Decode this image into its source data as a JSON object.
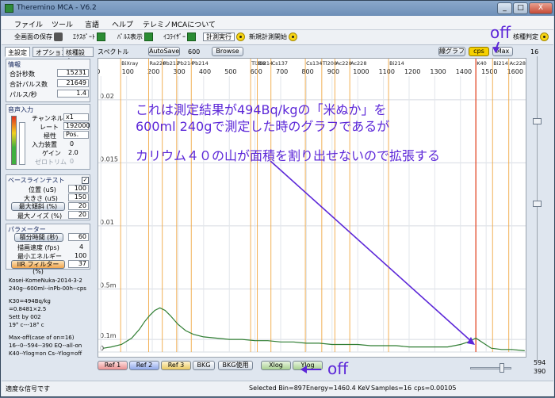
{
  "window": {
    "title": "Theremino MCA - V6.2"
  },
  "titlebar_buttons": {
    "minimize": "_",
    "maximize": "□",
    "close": "X"
  },
  "menu": [
    "ファイル",
    "ツール",
    "言語",
    "ヘルプ",
    "テレミノMCAについて"
  ],
  "toolbar": {
    "save_all": "全画面の保存",
    "export": "ｴｸｽﾎﾟｰﾄ",
    "pulse_display": "ﾊﾟﾙｽ表示",
    "equalizer": "ｲｺﾗｲｻﾞｰ",
    "measure_run": "計測実行",
    "new_measure": "新規計測開始",
    "nuclide_judge": "核種判定"
  },
  "tabs": [
    "主設定",
    "オプション",
    "核種設定"
  ],
  "info": {
    "title": "情報",
    "rows": [
      {
        "label": "合計秒数",
        "value": "15231"
      },
      {
        "label": "合計パルス数",
        "value": "21649"
      },
      {
        "label": "パルス/秒",
        "value": "1.4"
      }
    ]
  },
  "audio": {
    "title": "音声入力",
    "rows": [
      {
        "label": "チャンネル",
        "value": "x1"
      },
      {
        "label": "レート",
        "value": "192000"
      },
      {
        "label": "極性",
        "value": "Pos."
      },
      {
        "label": "入力装置",
        "value": "0"
      },
      {
        "label": "ゲイン",
        "value": "2.0"
      },
      {
        "label": "ゼロトリム",
        "value": "0"
      }
    ]
  },
  "baseline": {
    "title": "ベースラインテスト",
    "rows": [
      {
        "label": "位置 (uS)",
        "value": "100"
      },
      {
        "label": "大きさ (uS)",
        "value": "150"
      },
      {
        "label": "最大傾斜 (%)",
        "value": "20"
      },
      {
        "label": "最大ノイズ (%)",
        "value": "20"
      }
    ]
  },
  "params": {
    "title": "パラメーター",
    "rows": [
      {
        "label": "積分時間 (秒)",
        "value": "60"
      },
      {
        "label": "描画速度 (fps)",
        "value": "4"
      },
      {
        "label": "最小エネルギー",
        "value": "100"
      },
      {
        "label": "IIR フィルター (%)",
        "value": "37"
      }
    ]
  },
  "notes": [
    "Kosei-KomeNuka-2014-3-2",
    "240g--600ml--inPb-00h--cps",
    "",
    "K30=494Bq/kg",
    "=0.8481×2.5",
    "Sett by 002",
    "19° c---18° c",
    "",
    "Max-off(case of on=16)",
    "16--0--594--390  EQ--all-on",
    "K40--Ylog=on  Cs--Ylog=off"
  ],
  "spectrum": {
    "label": "スペクトル",
    "autosave": "AutoSave",
    "autosave_value": "600",
    "browse": "Browse",
    "line_graph": "線グラフ",
    "cps": "cps",
    "max": "Max",
    "scroll_top": "16"
  },
  "chart_data": {
    "type": "line",
    "x_ticks": [
      "0",
      "100",
      "200",
      "300",
      "400",
      "500",
      "600",
      "700",
      "800",
      "900",
      "1000",
      "1100",
      "1200",
      "1300",
      "1400",
      "1500",
      "1600"
    ],
    "y_ticks": [
      "0.02",
      "0.015",
      "0.01",
      "0.5m",
      "0.1m",
      "0"
    ],
    "xlim": [
      -10,
      1660
    ],
    "ylim": [
      0,
      0.0215
    ],
    "nuclide_labels": [
      {
        "name": "BiXray",
        "x": 77
      },
      {
        "name": "Ra226",
        "x": 186
      },
      {
        "name": "Pb212",
        "x": 239
      },
      {
        "name": "Pb214",
        "x": 295
      },
      {
        "name": "Pb214",
        "x": 352
      },
      {
        "name": "Tl208",
        "x": 583
      },
      {
        "name": "Bi214",
        "x": 609
      },
      {
        "name": "Cs137",
        "x": 662
      },
      {
        "name": "Tl208",
        "x": 860
      },
      {
        "name": "Cs134",
        "x": 796
      },
      {
        "name": "Ac228",
        "x": 911
      },
      {
        "name": "Ac228",
        "x": 969
      },
      {
        "name": "Bi214",
        "x": 1120
      },
      {
        "name": "K40",
        "x": 1460
      },
      {
        "name": "Bi214",
        "x": 1525
      },
      {
        "name": "Ac228",
        "x": 1588
      }
    ],
    "series": [
      {
        "x": [
          10,
          40,
          80,
          120,
          150,
          170,
          190,
          210,
          230,
          250,
          270,
          300,
          330,
          360,
          400,
          450,
          500,
          550,
          600,
          650,
          700,
          750,
          800,
          850,
          900,
          950,
          1000,
          1050,
          1100,
          1150,
          1200,
          1250,
          1300,
          1350,
          1400,
          1430,
          1460,
          1490,
          1520,
          1560,
          1600,
          1650
        ],
        "y": [
          0.0003,
          0.0004,
          0.0006,
          0.0011,
          0.0018,
          0.0024,
          0.0029,
          0.0033,
          0.0035,
          0.0033,
          0.0029,
          0.0022,
          0.0017,
          0.0014,
          0.0012,
          0.0011,
          0.001,
          0.001,
          0.0009,
          0.0009,
          0.0008,
          0.0008,
          0.0007,
          0.0007,
          0.0006,
          0.0006,
          0.0006,
          0.0005,
          0.0005,
          0.0005,
          0.0004,
          0.0004,
          0.0004,
          0.0004,
          0.0006,
          0.0008,
          0.0011,
          0.0007,
          0.0003,
          0.0002,
          0.0002,
          0.0001
        ]
      }
    ]
  },
  "annotation": {
    "line1": "これは測定結果が494Bq/kgの「米ぬか」を",
    "line2": "600ml  240gで測定した時のグラフであるが",
    "line3": "カリウム４０の山が面積を割り出せないので拡張する",
    "off_top": "off",
    "off_bottom": "off"
  },
  "bottom": {
    "ref1": "Ref 1",
    "ref2": "Ref 2",
    "ref3": "Ref 3",
    "bkg": "BKG",
    "bkg_use": "BKG使用",
    "xlog": "Xlog",
    "ylog": "Ylog",
    "scroll_a": "594",
    "scroll_b": "390"
  },
  "status": {
    "signal": "適度な信号です",
    "selected": "Selected Bin=897",
    "energy": "Energy=1460.4 KeV",
    "samples": "Samples=16",
    "cps": "cps=0.00105"
  },
  "colors": {
    "nuclide_line": "#f0a43a",
    "k40_line": "#e55030",
    "spectrum": "#2f7d32",
    "annotation": "#5c27d8"
  }
}
